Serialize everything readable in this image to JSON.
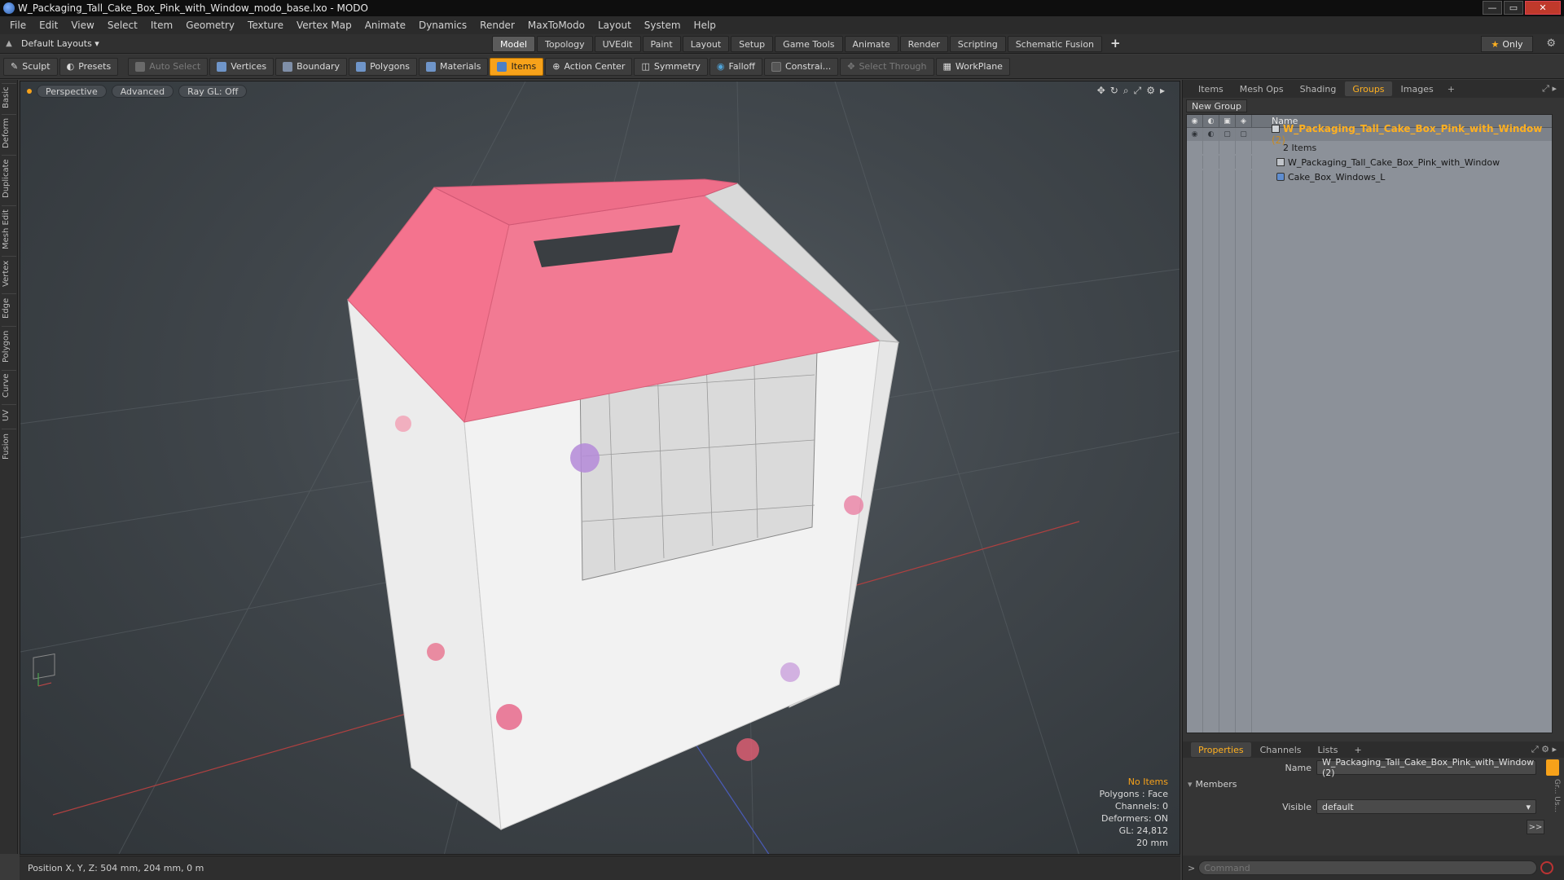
{
  "window": {
    "title": "W_Packaging_Tall_Cake_Box_Pink_with_Window_modo_base.lxo - MODO",
    "buttons": {
      "minimize": "—",
      "maximize": "▭",
      "close": "✕"
    }
  },
  "menu": [
    "File",
    "Edit",
    "View",
    "Select",
    "Item",
    "Geometry",
    "Texture",
    "Vertex Map",
    "Animate",
    "Dynamics",
    "Render",
    "MaxToModo",
    "Layout",
    "System",
    "Help"
  ],
  "layoutbar": {
    "layouts_label": "Default Layouts ▾",
    "tabs": [
      "Model",
      "Topology",
      "UVEdit",
      "Paint",
      "Layout",
      "Setup",
      "Game Tools",
      "Animate",
      "Render",
      "Scripting",
      "Schematic Fusion"
    ],
    "active_tab": "Model",
    "plus": "+",
    "only_label": "Only"
  },
  "toolbar": {
    "sculpt": "Sculpt",
    "presets": "Presets",
    "auto_select": "Auto Select",
    "vertices": "Vertices",
    "boundary": "Boundary",
    "polygons": "Polygons",
    "materials": "Materials",
    "items": "Items",
    "action_center": "Action Center",
    "symmetry": "Symmetry",
    "falloff": "Falloff",
    "constraints": "Constrai...",
    "select_through": "Select Through",
    "workplane": "WorkPlane"
  },
  "left_tabs": [
    "Basic",
    "Deform",
    "Duplicate",
    "Mesh Edit",
    "Vertex",
    "Edge",
    "Polygon",
    "Curve",
    "UV",
    "Fusion"
  ],
  "viewport": {
    "view_mode": "Perspective",
    "shading": "Advanced",
    "raygl": "Ray GL: Off",
    "info": {
      "no_items": "No Items",
      "polygons": "Polygons : Face",
      "channels": "Channels: 0",
      "deformers": "Deformers: ON",
      "gl": "GL: 24,812",
      "scale": "20 mm"
    }
  },
  "statusbar": {
    "position": "Position X, Y, Z:   504 mm, 204 mm, 0 m"
  },
  "rightpanel": {
    "tabs": [
      "Items",
      "Mesh Ops",
      "Shading",
      "Groups",
      "Images"
    ],
    "active_tab": "Groups",
    "new_group": "New Group",
    "list_header": "Name",
    "group": {
      "name": "W_Packaging_Tall_Cake_Box_Pink_with_Window",
      "count": "(2)"
    },
    "items_count": "2 Items",
    "members": [
      "W_Packaging_Tall_Cake_Box_Pink_with_Window",
      "Cake_Box_Windows_L"
    ]
  },
  "properties": {
    "tabs": [
      "Properties",
      "Channels",
      "Lists"
    ],
    "active_tab": "Properties",
    "name_label": "Name",
    "name_value": "W_Packaging_Tall_Cake_Box_Pink_with_Window (2)",
    "members_label": "Members",
    "visible_label": "Visible",
    "visible_value": "default",
    "arrow": ">>"
  },
  "command": {
    "placeholder": "Command",
    "prompt": ">"
  },
  "colors": {
    "accent": "#f7a21a",
    "pink": "#f4738e",
    "viewport_bg": "#40464b"
  }
}
